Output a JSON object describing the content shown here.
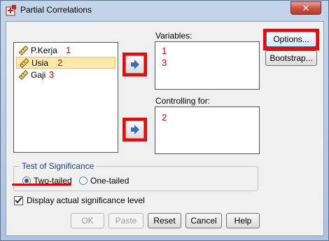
{
  "window": {
    "title": "Partial Correlations",
    "close_glyph": "✕"
  },
  "source_list": {
    "items": [
      {
        "label": "P.Kerja",
        "marker": "1",
        "selected": false
      },
      {
        "label": "Usia",
        "marker": "2",
        "selected": true
      },
      {
        "label": "Gaji",
        "marker": "3",
        "selected": false
      }
    ]
  },
  "variables": {
    "label": "Variables:",
    "items": [
      "1",
      "3"
    ]
  },
  "controlling": {
    "label": "Controlling for:",
    "items": [
      "2"
    ]
  },
  "side_buttons": {
    "options": "Options...",
    "bootstrap": "Bootstrap..."
  },
  "significance": {
    "title": "Test of Significance",
    "two_tailed": "Two-tailed",
    "one_tailed": "One-tailed",
    "selected": "two_tailed"
  },
  "display_actual": {
    "label": "Display actual significance level",
    "checked": true
  },
  "footer": {
    "ok": "OK",
    "paste": "Paste",
    "reset": "Reset",
    "cancel": "Cancel",
    "help": "Help"
  },
  "colors": {
    "highlight": "#ff0000",
    "selection": "#fde9a6",
    "marker_text": "#d20000"
  },
  "icons": [
    "app-icon",
    "ruler-variable-icon",
    "arrow-right-icon",
    "close-icon",
    "checkmark-icon"
  ]
}
